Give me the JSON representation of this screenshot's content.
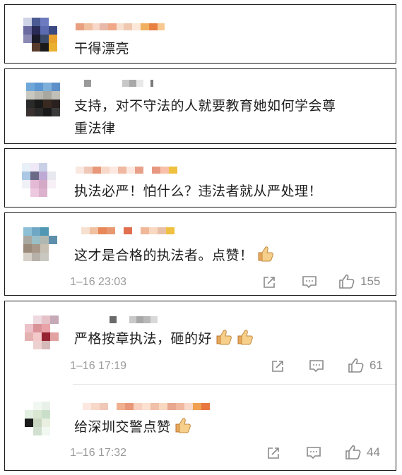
{
  "comments": [
    {
      "text_lines": [
        "干得漂亮"
      ]
    },
    {
      "text_lines": [
        "支持，对不守法的人就要教育她如何学会尊",
        "重法律"
      ]
    },
    {
      "text_lines": [
        "执法必严！怕什么？违法者就从严处理！"
      ]
    },
    {
      "text_lines": [
        "这才是合格的执法者。点赞！"
      ],
      "time": "1–16 23:03",
      "likes": "155"
    },
    {
      "text_lines": [
        "严格按章执法，砸的好"
      ],
      "time": "1–16 17:19",
      "likes": "61"
    },
    {
      "text_lines": [
        "给深圳交警点赞"
      ],
      "time": "1–16 17:32",
      "likes": "44"
    }
  ],
  "icons": {
    "share": "share-icon",
    "comment": "comment-icon",
    "like": "thumbs-up-icon",
    "emoji": "thumbs-up-emoji"
  },
  "colors": {
    "meta_text": "#9a9a9a",
    "border": "#1a1a1a",
    "emoji_skin": "#f2c27a"
  }
}
